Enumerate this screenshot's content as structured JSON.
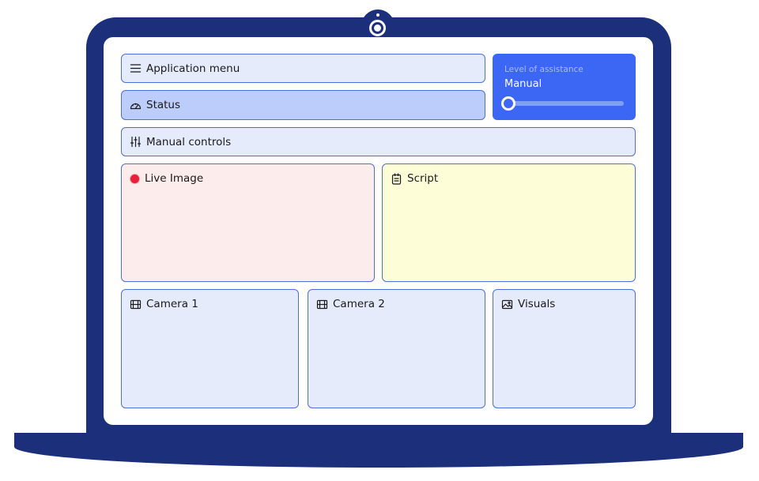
{
  "panels": {
    "application_menu": {
      "label": "Application menu",
      "icon": "hamburger-menu-icon"
    },
    "status": {
      "label": "Status",
      "icon": "gauge-icon"
    },
    "manual_controls": {
      "label": "Manual controls",
      "icon": "sliders-icon"
    },
    "live_image": {
      "label": "Live Image",
      "icon": "record-icon"
    },
    "script": {
      "label": "Script",
      "icon": "clipboard-icon"
    },
    "camera_1": {
      "label": "Camera 1",
      "icon": "film-icon"
    },
    "camera_2": {
      "label": "Camera 2",
      "icon": "film-icon"
    },
    "visuals": {
      "label": "Visuals",
      "icon": "image-icon"
    }
  },
  "assistance": {
    "caption": "Level of assistance",
    "value": "Manual",
    "slider_fraction": 0.0
  },
  "colors": {
    "device": "#1b2f7b",
    "accent": "#3c66f4",
    "panel_border": "#4a6ee0",
    "panel_fill": "#e6ebfc",
    "status_fill": "#bdcdfb",
    "live_fill": "#fcecec",
    "script_fill": "#fdfdd8",
    "record": "#e8203a"
  }
}
